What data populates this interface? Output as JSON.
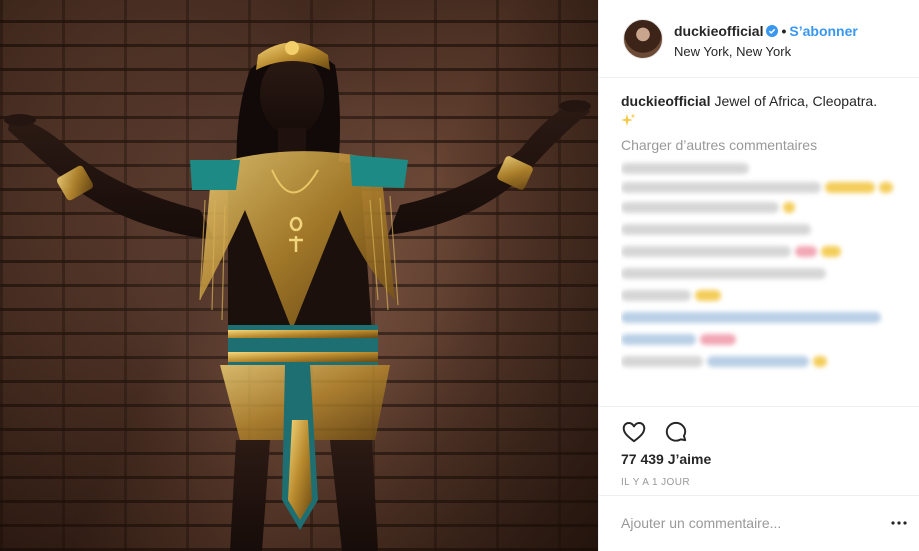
{
  "header": {
    "username": "duckieofficial",
    "separator": "•",
    "follow_label": "S’abonner",
    "location": "New York, New York"
  },
  "caption": {
    "username": "duckieofficial",
    "text": "Jewel of Africa, Cleopatra."
  },
  "comments": {
    "load_more_label": "Charger d’autres commentaires",
    "blurred_rows": 11
  },
  "actions": {
    "likes": "77 439 J’aime",
    "timestamp": "IL Y A 1 JOUR"
  },
  "add_comment": {
    "placeholder": "Ajouter un commentaire..."
  },
  "icons": {
    "verified": "verified-badge-icon",
    "like": "heart-icon",
    "comment": "comment-bubble-icon",
    "more": "ellipsis-icon",
    "sparkle": "sparkles-icon"
  },
  "colors": {
    "accent_blue": "#3897f0",
    "text_primary": "#262626",
    "text_secondary": "#999999",
    "divider": "#efefef"
  }
}
